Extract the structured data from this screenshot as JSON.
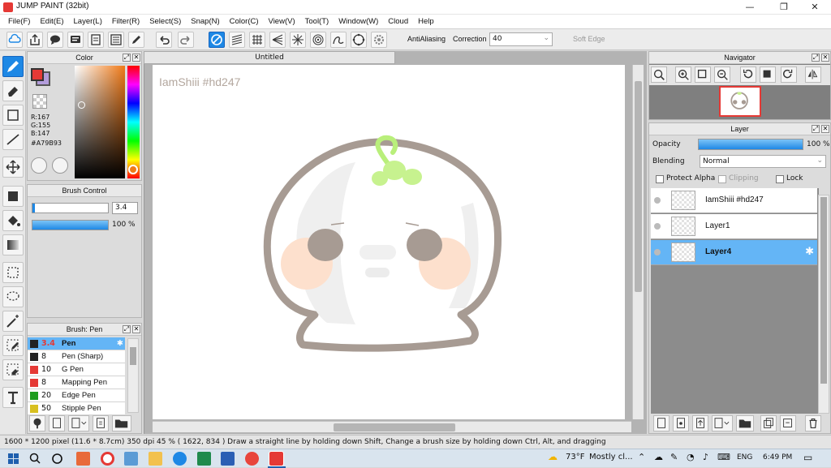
{
  "window": {
    "title": "JUMP PAINT (32bit)",
    "minimize": "—",
    "maximize": "❐",
    "close": "✕"
  },
  "menu": [
    "File(F)",
    "Edit(E)",
    "Layer(L)",
    "Filter(R)",
    "Select(S)",
    "Snap(N)",
    "Color(C)",
    "View(V)",
    "Tool(T)",
    "Window(W)",
    "Cloud",
    "Help"
  ],
  "toolbar": {
    "antialiasing_label": "AntiAliasing",
    "antialiasing_checked": true,
    "correction_label": "Correction",
    "correction_value": "40",
    "soft_edge_label": "Soft Edge",
    "soft_edge_checked": false,
    "icons": [
      "cloud-icon",
      "share-icon",
      "chat-icon",
      "comment-icon",
      "page-icon",
      "list-icon",
      "edit-icon",
      "undo-icon",
      "redo-icon",
      "no-snap-icon",
      "parallel-snap-icon",
      "grid-snap-icon",
      "vanishing-snap-icon",
      "radial-snap-icon",
      "concentric-snap-icon",
      "curve-snap-icon",
      "ellipse-snap-icon",
      "snap-settings-icon"
    ]
  },
  "tools": [
    "brush-tool-icon",
    "eraser-tool-icon",
    "rectangle-tool-icon",
    "line-tool-icon",
    "move-tool-icon",
    "fill-rect-tool-icon",
    "bucket-tool-icon",
    "gradient-tool-icon",
    "select-rect-icon",
    "lasso-icon",
    "magic-wand-icon",
    "select-pen-icon",
    "select-eraser-icon",
    "text-tool-icon"
  ],
  "color_panel": {
    "title": "Color",
    "r": "R:167",
    "g": "G:155",
    "b": "B:147",
    "hex": "#A79B93",
    "primary": "#e53935",
    "secondary": "#b39ddb"
  },
  "brush_control": {
    "title": "Brush Control",
    "size": "3.4",
    "opacity": "100 %",
    "opacity_fraction": 1.0
  },
  "brush_panel": {
    "title": "Brush: Pen",
    "items": [
      {
        "size": "3.4",
        "name": "Pen",
        "color": "#222222"
      },
      {
        "size": "8",
        "name": "Pen (Sharp)",
        "color": "#222222"
      },
      {
        "size": "10",
        "name": "G Pen",
        "color": "#e53935"
      },
      {
        "size": "8",
        "name": "Mapping Pen",
        "color": "#e53935"
      },
      {
        "size": "20",
        "name": "Edge Pen",
        "color": "#1f9d1f"
      },
      {
        "size": "50",
        "name": "Stipple Pen",
        "color": "#d8c020"
      }
    ]
  },
  "canvas": {
    "tab_title": "Untitled",
    "watermark": "IamShiii #hd247"
  },
  "navigator": {
    "title": "Navigator"
  },
  "layer_panel": {
    "title": "Layer",
    "opacity_label": "Opacity",
    "opacity_value": "100 %",
    "opacity_fraction": 1.0,
    "blending_label": "Blending",
    "blending_value": "Normal",
    "protect_alpha": "Protect Alpha",
    "clipping": "Clipping",
    "lock": "Lock",
    "layers": [
      {
        "name": "IamShiii #hd247",
        "selected": false
      },
      {
        "name": "Layer1",
        "selected": false
      },
      {
        "name": "Layer4",
        "selected": true
      }
    ]
  },
  "status": {
    "text": "1600 * 1200 pixel   (11.6 * 8.7cm)   350 dpi   45 %   ( 1622, 834 )   Draw a straight line by holding down Shift, Change a brush size by holding down Ctrl, Alt, and dragging"
  },
  "taskbar": {
    "weather": "73°F",
    "weather_desc": "Mostly cl...",
    "lang": "ENG",
    "time": "6:49 PM"
  }
}
